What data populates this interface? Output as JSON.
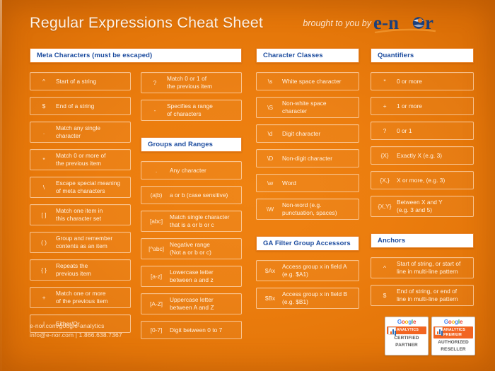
{
  "header": {
    "title": "Regular Expressions Cheat Sheet",
    "brought_by": "brought to you by",
    "logo_text": "e-nor",
    "logo_color": "#1b3f7a"
  },
  "theme": {
    "background_orange": "#ec7d0e",
    "background_orange_dark": "#cf6604",
    "section_header_bg": "#ffffff",
    "section_header_text": "#1b4b9e",
    "row_text": "#fff3e6"
  },
  "sections": {
    "meta_characters": {
      "title": "Meta Characters (must be escaped)",
      "left_items": [
        {
          "symbol": "^",
          "line1": "Start of a string",
          "line2": ""
        },
        {
          "symbol": "$",
          "line1": "End of a string",
          "line2": ""
        },
        {
          "symbol": ".",
          "line1": "Match any single",
          "line2": "character"
        },
        {
          "symbol": "*",
          "line1": "Match 0 or more of",
          "line2": "the previous item"
        },
        {
          "symbol": "\\",
          "line1": "Escape special meaning",
          "line2": "of meta characters"
        },
        {
          "symbol": "[ ]",
          "line1": "Match one item in",
          "line2": "this character set"
        },
        {
          "symbol": "( )",
          "line1": "Group and remember",
          "line2": "contents as an item"
        },
        {
          "symbol": "{ }",
          "line1": "Repeats the",
          "line2": "previous item"
        },
        {
          "symbol": "+",
          "line1": "Match one or more",
          "line2": "of the previous item"
        },
        {
          "symbol": "|",
          "line1": "Either/Or",
          "line2": ""
        }
      ],
      "right_items": [
        {
          "symbol": "?",
          "line1": "Match 0 or 1 of",
          "line2": "the previous item"
        },
        {
          "symbol": "-",
          "line1": "Specifies a range",
          "line2": "of characters"
        }
      ]
    },
    "groups_and_ranges": {
      "title": "Groups and Ranges",
      "items": [
        {
          "symbol": ".",
          "line1": "Any character",
          "line2": ""
        },
        {
          "symbol": "(a|b)",
          "line1": "a or b (case sensitive)",
          "line2": ""
        },
        {
          "symbol": "[abc]",
          "line1": "Match single character",
          "line2": "that is a or b or c"
        },
        {
          "symbol": "[^abc]",
          "line1": "Negative range",
          "line2": "(Not a or b or c)"
        },
        {
          "symbol": "[a-z]",
          "line1": "Lowercase letter",
          "line2": "between a and z"
        },
        {
          "symbol": "[A-Z]",
          "line1": "Uppercase letter",
          "line2": "between A and Z"
        },
        {
          "symbol": "[0-7]",
          "line1": "Digit between 0 to 7",
          "line2": ""
        }
      ]
    },
    "character_classes": {
      "title": "Character Classes",
      "items": [
        {
          "symbol": "\\s",
          "line1": "White space character",
          "line2": ""
        },
        {
          "symbol": "\\S",
          "line1": "Non-white space",
          "line2": "character"
        },
        {
          "symbol": "\\d",
          "line1": "Digit character",
          "line2": ""
        },
        {
          "symbol": "\\D",
          "line1": "Non-digit character",
          "line2": ""
        },
        {
          "symbol": "\\w",
          "line1": "Word",
          "line2": ""
        },
        {
          "symbol": "\\W",
          "line1": "Non-word (e.g.",
          "line2": "punctuation, spaces)"
        }
      ]
    },
    "ga_filter_group_accessors": {
      "title": "GA Filter Group Accessors",
      "items": [
        {
          "symbol": "$Ax",
          "line1": "Access group x in field A",
          "line2": "(e.g. $A1)"
        },
        {
          "symbol": "$Bx",
          "line1": "Access group x in field B",
          "line2": "(e.g. $B1)"
        }
      ]
    },
    "quantifiers": {
      "title": "Quantifiers",
      "items": [
        {
          "symbol": "*",
          "line1": "0 or more",
          "line2": ""
        },
        {
          "symbol": "+",
          "line1": "1 or more",
          "line2": ""
        },
        {
          "symbol": "?",
          "line1": "0 or 1",
          "line2": ""
        },
        {
          "symbol": "{X}",
          "line1": "Exactly X (e.g. 3)",
          "line2": ""
        },
        {
          "symbol": "{X,}",
          "line1": "X or more, (e.g. 3)",
          "line2": ""
        },
        {
          "symbol": "{X,Y}",
          "line1": "Between X and Y",
          "line2": "(e.g. 3 and 5)"
        }
      ]
    },
    "anchors": {
      "title": "Anchors",
      "items": [
        {
          "symbol": "^",
          "line1": "Start of string, or start of",
          "line2": "line in multi-line pattern"
        },
        {
          "symbol": "$",
          "line1": "End of string, or end of",
          "line2": "line in multi-line pattern"
        }
      ]
    }
  },
  "footer": {
    "website": "e-nor.com/google-analytics",
    "contact": "info@e-nor.com  |  1.866.638.7367"
  },
  "badges": [
    {
      "google": "Google",
      "product": "ANALYTICS",
      "product2": "",
      "role_line1": "CERTIFIED",
      "role_line2": "PARTNER"
    },
    {
      "google": "Google",
      "product": "ANALYTICS",
      "product2": "PREMIUM",
      "role_line1": "AUTHORIZED",
      "role_line2": "RESELLER"
    }
  ]
}
